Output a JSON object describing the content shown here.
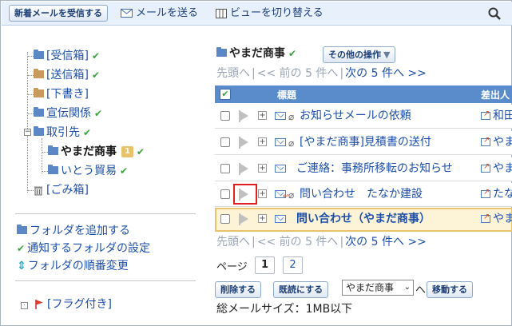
{
  "toolbar": {
    "receive_label": "新着メールを受信する",
    "send_label": "メールを送る",
    "view_label": "ビューを切り替える"
  },
  "folders": [
    {
      "label": "[受信箱]",
      "color": "#5b88c5",
      "checked": true
    },
    {
      "label": "[送信箱]",
      "color": "#c99a5b",
      "checked": true
    },
    {
      "label": "[下書き]",
      "color": "#c99a5b",
      "checked": false
    },
    {
      "label": "宣伝関係",
      "color": "#5b88c5",
      "checked": true
    },
    {
      "label": "取引先",
      "color": "#5b88c5",
      "checked": true
    },
    {
      "label": "やまだ商事",
      "color": "#5b88c5",
      "checked": true,
      "unread": "1",
      "current": true
    },
    {
      "label": "いとう貿易",
      "color": "#5b88c5",
      "checked": true
    },
    {
      "label": "[ごみ箱]",
      "color": "#888888",
      "checked": false
    }
  ],
  "folder_actions": {
    "add": "フォルダを追加する",
    "notify": "通知するフォルダの設定",
    "order": "フォルダの順番変更"
  },
  "flagged_label": "[フラグ付き]",
  "main": {
    "folder_title": "やまだ商事",
    "other_ops": "その他の操作",
    "pager": {
      "first": "先頭へ",
      "prev": "<< 前の 5 件へ",
      "next": "次の 5 件へ >>"
    },
    "columns": {
      "subject": "標題",
      "sender": "差出人"
    },
    "rows": [
      {
        "subject": "お知らせメールの依頼",
        "sender": "和田",
        "selected": false
      },
      {
        "subject": "[やまだ商事]見積書の送付",
        "sender": "やま",
        "selected": false
      },
      {
        "subject": "ご連絡：事務所移転のお知らせ",
        "sender": "やま",
        "selected": false
      },
      {
        "subject": "問い合わせ　たなか建設",
        "sender": "たな",
        "selected": false
      },
      {
        "subject": "問い合わせ（やまだ商事）",
        "sender": "やま",
        "selected": true
      }
    ],
    "page_label": "ページ",
    "pages": [
      "1",
      "2"
    ],
    "delete_btn": "削除する",
    "read_btn": "既読にする",
    "move_select": "やまだ商事",
    "move_to": "へ",
    "move_btn": "移動する",
    "total_size": "総メールサイズ：1MB以下"
  }
}
